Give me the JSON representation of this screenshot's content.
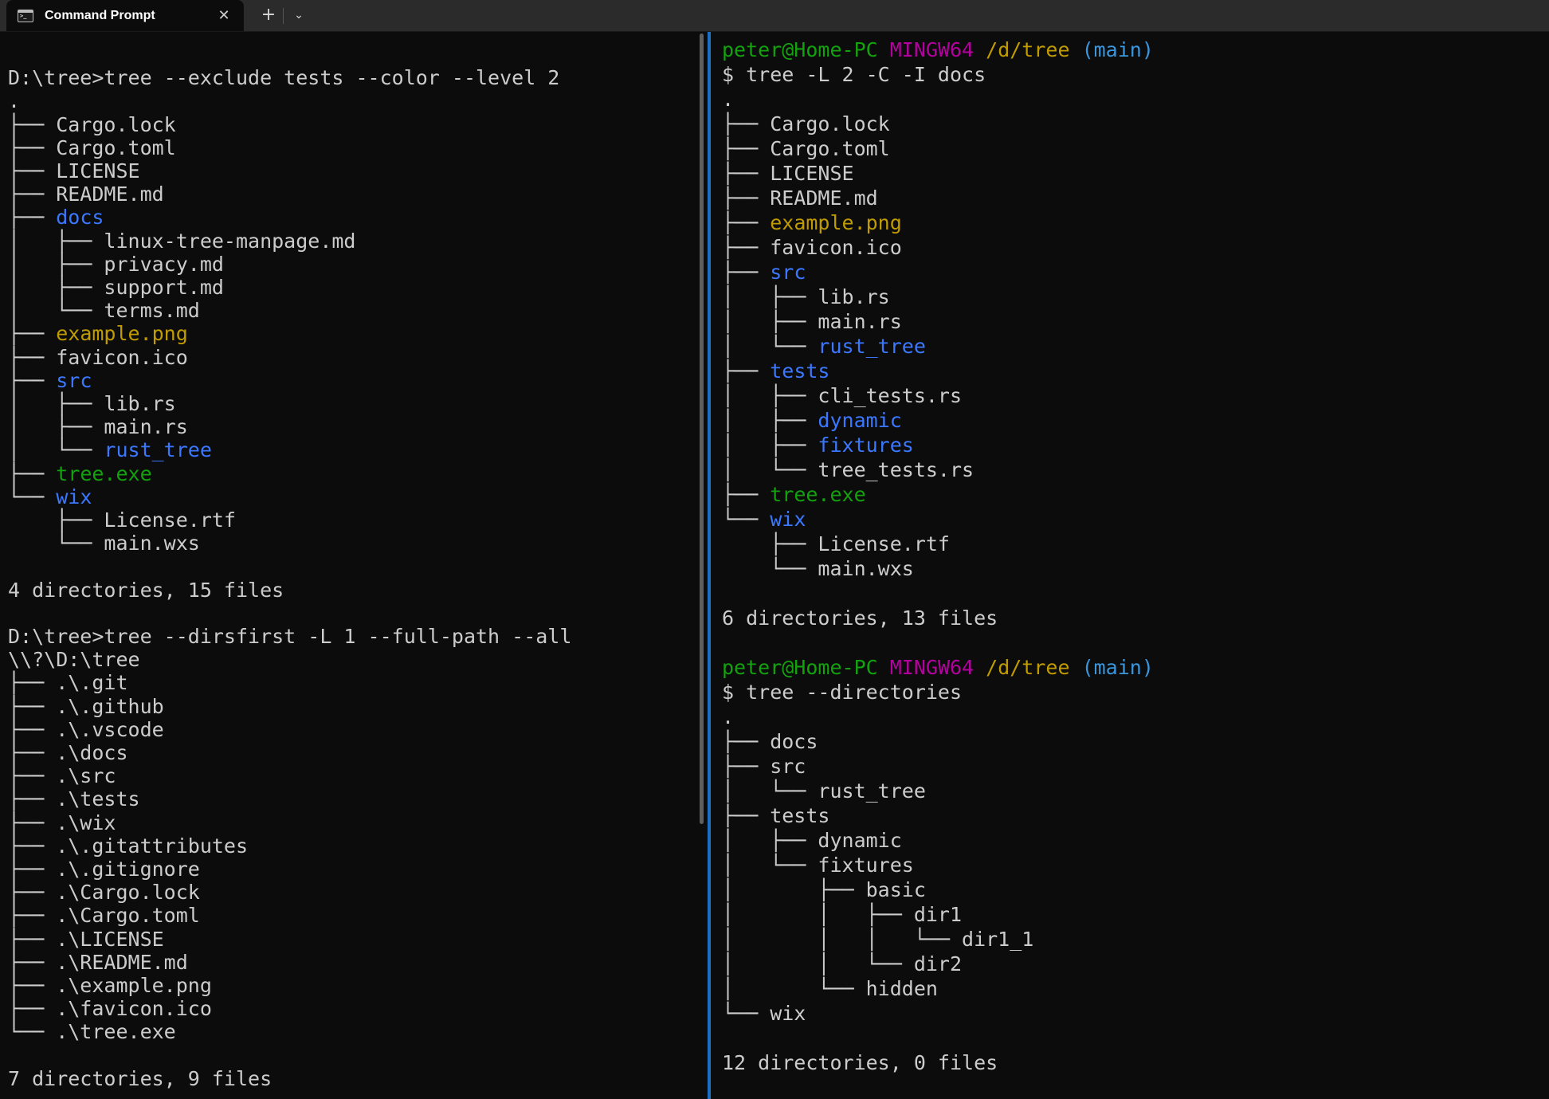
{
  "window": {
    "tab_title": "Command Prompt",
    "tab_icon": "terminal-icon",
    "close_glyph": "✕",
    "new_tab_glyph": "+",
    "dropdown_glyph": "⌄"
  },
  "colors": {
    "directory": "#3b78ff",
    "image": "#c19c00",
    "executable": "#13a10e",
    "text": "#cccccc",
    "prompt_user": "#13a10e",
    "prompt_env": "#b4009e",
    "prompt_path": "#c19c00",
    "prompt_branch": "#3a96dd",
    "divider": "#1c6fc7"
  },
  "left_pane": {
    "lines": [
      {
        "t": ""
      },
      {
        "t": "D:\\tree>tree --exclude tests --color --level 2"
      },
      {
        "t": "."
      },
      {
        "t": "├── Cargo.lock"
      },
      {
        "t": "├── Cargo.toml"
      },
      {
        "t": "├── LICENSE"
      },
      {
        "t": "├── README.md"
      },
      {
        "p": "├── ",
        "n": "docs",
        "c": "dir"
      },
      {
        "t": "│   ├── linux-tree-manpage.md"
      },
      {
        "t": "│   ├── privacy.md"
      },
      {
        "t": "│   ├── support.md"
      },
      {
        "t": "│   └── terms.md"
      },
      {
        "p": "├── ",
        "n": "example.png",
        "c": "img"
      },
      {
        "t": "├── favicon.ico"
      },
      {
        "p": "├── ",
        "n": "src",
        "c": "dir"
      },
      {
        "t": "│   ├── lib.rs"
      },
      {
        "t": "│   ├── main.rs"
      },
      {
        "p": "│   └── ",
        "n": "rust_tree",
        "c": "dir"
      },
      {
        "p": "├── ",
        "n": "tree.exe",
        "c": "exe"
      },
      {
        "p": "└── ",
        "n": "wix",
        "c": "dir"
      },
      {
        "t": "    ├── License.rtf"
      },
      {
        "t": "    └── main.wxs"
      },
      {
        "t": ""
      },
      {
        "t": "4 directories, 15 files"
      },
      {
        "t": ""
      },
      {
        "t": "D:\\tree>tree --dirsfirst -L 1 --full-path --all"
      },
      {
        "t": "\\\\?\\D:\\tree"
      },
      {
        "t": "├── .\\.git"
      },
      {
        "t": "├── .\\.github"
      },
      {
        "t": "├── .\\.vscode"
      },
      {
        "t": "├── .\\docs"
      },
      {
        "t": "├── .\\src"
      },
      {
        "t": "├── .\\tests"
      },
      {
        "t": "├── .\\wix"
      },
      {
        "t": "├── .\\.gitattributes"
      },
      {
        "t": "├── .\\.gitignore"
      },
      {
        "t": "├── .\\Cargo.lock"
      },
      {
        "t": "├── .\\Cargo.toml"
      },
      {
        "t": "├── .\\LICENSE"
      },
      {
        "t": "├── .\\README.md"
      },
      {
        "t": "├── .\\example.png"
      },
      {
        "t": "├── .\\favicon.ico"
      },
      {
        "t": "└── .\\tree.exe"
      },
      {
        "t": ""
      },
      {
        "t": "7 directories, 9 files"
      }
    ]
  },
  "right_pane": {
    "prompt_user": "peter@Home-PC",
    "prompt_env": "MINGW64",
    "prompt_path": "/d/tree",
    "prompt_branch": "(main)",
    "lines": [
      {
        "prompt": true
      },
      {
        "t": "$ tree -L 2 -C -I docs"
      },
      {
        "t": "."
      },
      {
        "t": "├── Cargo.lock"
      },
      {
        "t": "├── Cargo.toml"
      },
      {
        "t": "├── LICENSE"
      },
      {
        "t": "├── README.md"
      },
      {
        "p": "├── ",
        "n": "example.png",
        "c": "img"
      },
      {
        "t": "├── favicon.ico"
      },
      {
        "p": "├── ",
        "n": "src",
        "c": "dir"
      },
      {
        "t": "│   ├── lib.rs"
      },
      {
        "t": "│   ├── main.rs"
      },
      {
        "p": "│   └── ",
        "n": "rust_tree",
        "c": "dir"
      },
      {
        "p": "├── ",
        "n": "tests",
        "c": "dir"
      },
      {
        "t": "│   ├── cli_tests.rs"
      },
      {
        "p": "│   ├── ",
        "n": "dynamic",
        "c": "dir"
      },
      {
        "p": "│   ├── ",
        "n": "fixtures",
        "c": "dir"
      },
      {
        "t": "│   └── tree_tests.rs"
      },
      {
        "p": "├── ",
        "n": "tree.exe",
        "c": "exe"
      },
      {
        "p": "└── ",
        "n": "wix",
        "c": "dir"
      },
      {
        "t": "    ├── License.rtf"
      },
      {
        "t": "    └── main.wxs"
      },
      {
        "t": ""
      },
      {
        "t": "6 directories, 13 files"
      },
      {
        "t": ""
      },
      {
        "prompt": true
      },
      {
        "t": "$ tree --directories"
      },
      {
        "t": "."
      },
      {
        "t": "├── docs"
      },
      {
        "t": "├── src"
      },
      {
        "t": "│   └── rust_tree"
      },
      {
        "t": "├── tests"
      },
      {
        "t": "│   ├── dynamic"
      },
      {
        "t": "│   └── fixtures"
      },
      {
        "t": "│       ├── basic"
      },
      {
        "t": "│       │   ├── dir1"
      },
      {
        "t": "│       │   │   └── dir1_1"
      },
      {
        "t": "│       │   └── dir2"
      },
      {
        "t": "│       └── hidden"
      },
      {
        "t": "└── wix"
      },
      {
        "t": ""
      },
      {
        "t": "12 directories, 0 files"
      }
    ]
  }
}
